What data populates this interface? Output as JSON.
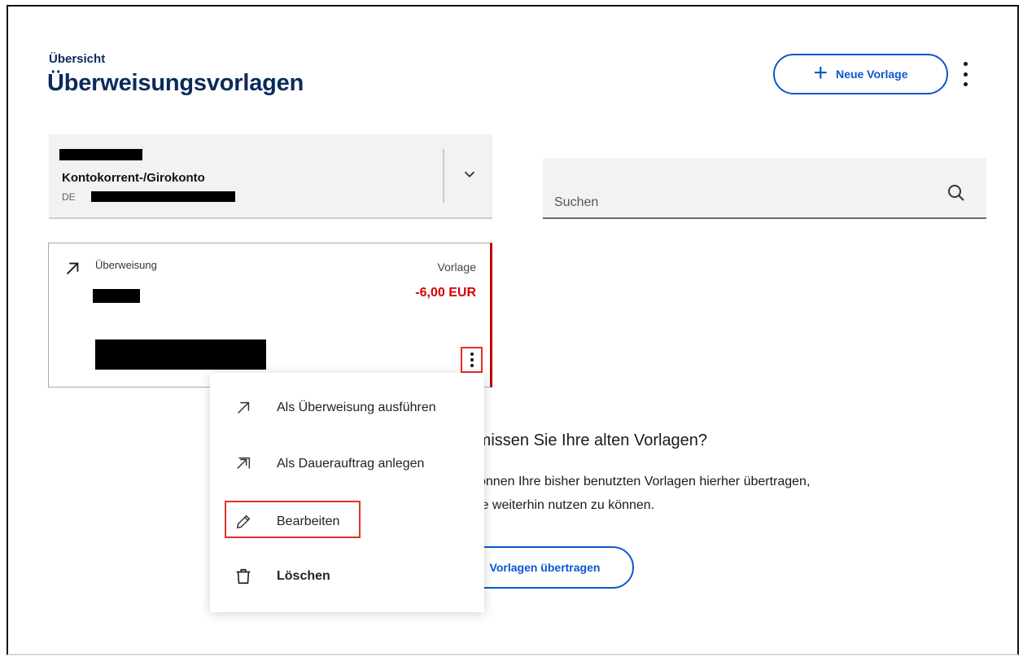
{
  "header": {
    "breadcrumb": "Übersicht",
    "title": "Überweisungsvorlagen",
    "new_template_label": "Neue Vorlage"
  },
  "account": {
    "name": "Kontokorrent-/Girokonto",
    "iban_prefix": "DE"
  },
  "search": {
    "placeholder": "Suchen"
  },
  "template_card": {
    "type": "Überweisung",
    "tag": "Vorlage",
    "amount": "-6,00 EUR"
  },
  "context_menu": {
    "items": [
      {
        "label": "Als Überweisung ausführen",
        "icon": "arrow-up-right-icon"
      },
      {
        "label": "Als Dauerauftrag anlegen",
        "icon": "standing-order-icon"
      },
      {
        "label": "Bearbeiten",
        "icon": "pencil-icon"
      },
      {
        "label": "Löschen",
        "icon": "trash-icon"
      }
    ]
  },
  "promo": {
    "title": "rmissen Sie Ihre alten Vorlagen?",
    "line1": "können Ihre bisher benutzten Vorlagen hierher übertragen,",
    "line2": "sie weiterhin nutzen zu können.",
    "button_label": "Vorlagen übertragen"
  },
  "colors": {
    "brand_blue": "#0b2a5b",
    "accent_blue": "#0b57d0",
    "negative_red": "#d40000",
    "highlight_red": "#e0312b"
  }
}
